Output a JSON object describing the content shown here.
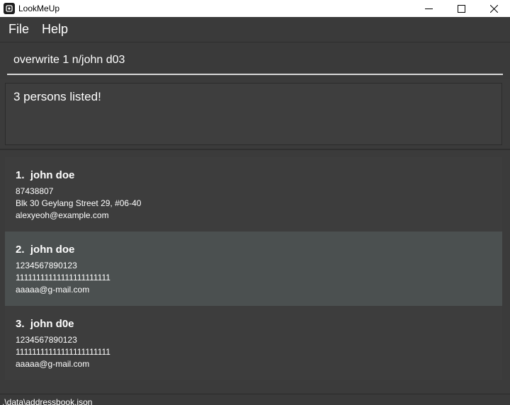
{
  "window": {
    "title": "LookMeUp",
    "icon": "app-logo-icon",
    "controls": [
      "minimize-icon",
      "maximize-icon",
      "close-icon"
    ]
  },
  "menu": {
    "file": "File",
    "help": "Help"
  },
  "command": {
    "value": "overwrite 1 n/john d03"
  },
  "result": {
    "text": "3 persons listed!"
  },
  "persons": [
    {
      "index": "1.",
      "name": "john doe",
      "phone": "87438807",
      "address": "Blk 30 Geylang Street 29, #06-40",
      "email": "alexyeoh@example.com",
      "selected": false
    },
    {
      "index": "2.",
      "name": "john doe",
      "phone": "1234567890123",
      "address": "11111111111111111111111",
      "email": "aaaaa@g-mail.com",
      "selected": true
    },
    {
      "index": "3.",
      "name": "john d0e",
      "phone": "1234567890123",
      "address": "11111111111111111111111",
      "email": "aaaaa@g-mail.com",
      "selected": false
    }
  ],
  "status": {
    "path": ".\\data\\addressbook.json"
  },
  "colors": {
    "background": "#3b3b3b",
    "selected_card": "#4b5050",
    "card": "#3d3d3d",
    "titlebar": "#ffffff"
  }
}
